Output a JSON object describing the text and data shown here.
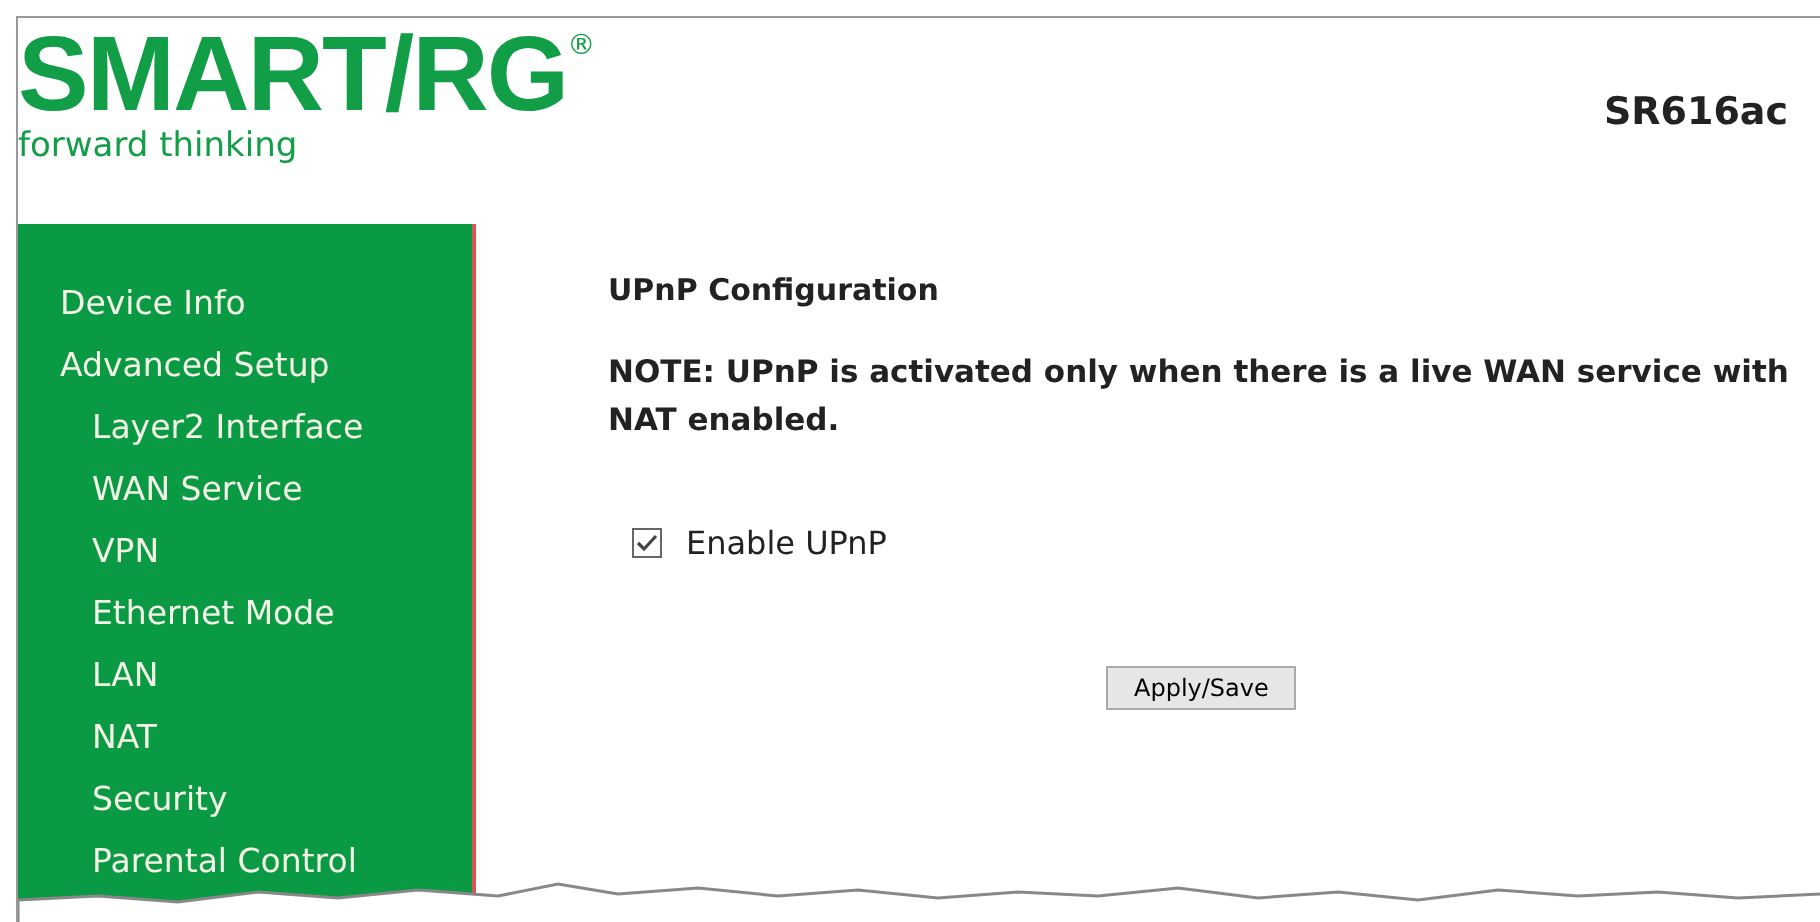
{
  "header": {
    "logo": "SMART/RG",
    "logo_mark": "®",
    "tagline": "forward thinking",
    "model": "SR616ac"
  },
  "sidebar": {
    "items": [
      {
        "label": "Device Info"
      },
      {
        "label": "Advanced Setup",
        "children": [
          {
            "label": "Layer2 Interface"
          },
          {
            "label": "WAN Service"
          },
          {
            "label": "VPN"
          },
          {
            "label": "Ethernet Mode"
          },
          {
            "label": "LAN"
          },
          {
            "label": "NAT"
          },
          {
            "label": "Security"
          },
          {
            "label": "Parental Control"
          }
        ]
      }
    ]
  },
  "content": {
    "title": "UPnP Configuration",
    "note": "NOTE: UPnP is activated only when there is a live WAN service with NAT enabled.",
    "checkbox": {
      "label": "Enable UPnP",
      "checked": true
    },
    "button": "Apply/Save"
  }
}
